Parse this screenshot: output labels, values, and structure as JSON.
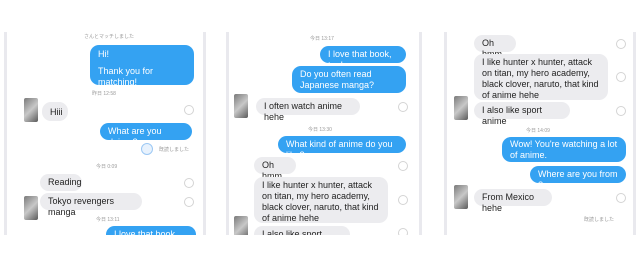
{
  "panel1": {
    "header_partial": "さんとマッチしました",
    "out1": [
      "Hi!",
      "Thank you for matching!"
    ],
    "ts1": "昨日 12:58",
    "in1": "Hiii",
    "out2": "What are you doing ?",
    "read_label": "既読しました",
    "ts2": "今日 0:09",
    "in2": "Reading",
    "in3": "Tokyo revengers manga",
    "ts3": "今日 13:11",
    "out_partial": "I love that book, too!"
  },
  "panel2": {
    "ts_top": "今日 13:17",
    "out1": "I love that book, too!",
    "out2": "Do you often read Japanese manga?",
    "in1": "I often watch anime hehe",
    "ts2": "今日 13:30",
    "out3": "What kind of anime do you like?",
    "in2": "Oh hmm",
    "in3": "I like hunter x hunter, attack on titan, my hero academy, black clover, naruto, that kind of anime hehe",
    "in4_partial": "I also like sport anime"
  },
  "panel3": {
    "in1": "Oh hmm",
    "in2": "I like hunter x hunter, attack on titan, my hero academy, black clover, naruto, that kind of anime hehe",
    "in3": "I also like sport anime",
    "ts1": "今日 14:09",
    "out1": "Wow! You're watching a lot of anime.",
    "out2": "Where are you from ?",
    "in4": "From Mexico hehe",
    "read_label": "既読しました"
  }
}
